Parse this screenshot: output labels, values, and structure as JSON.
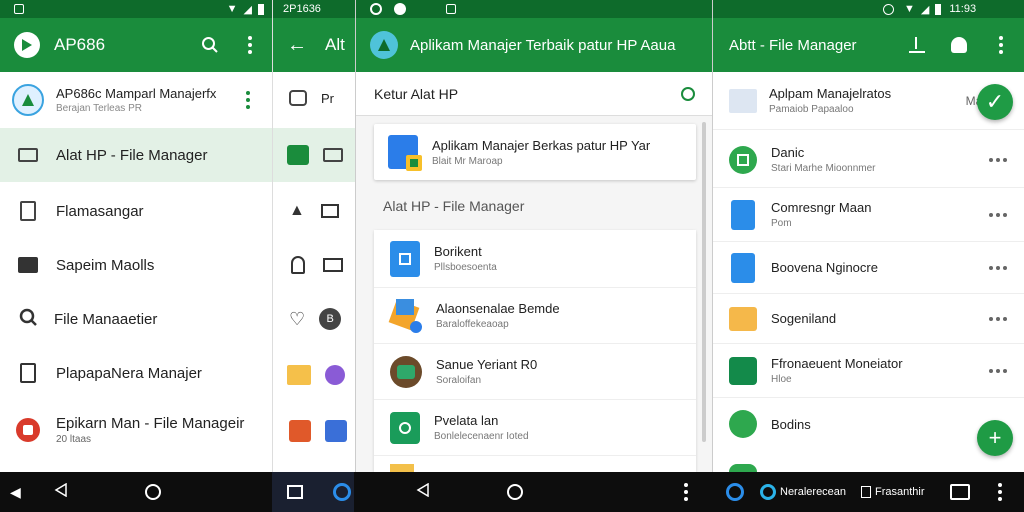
{
  "panel1": {
    "status_time": "",
    "appbar_title": "AP686",
    "account": {
      "name": "AP686c Mamparl Manajerfx",
      "sub": "Berajan Terleas PR"
    },
    "menu": [
      {
        "label": "Alat HP - File Manager",
        "icon": "screen-icon",
        "active": true
      },
      {
        "label": "Flamasangar",
        "icon": "document-icon"
      },
      {
        "label": "Sapeim Maolls",
        "icon": "folder-icon"
      },
      {
        "label": "File Manaaetier",
        "icon": "search-icon"
      },
      {
        "label": "PlapapaNera Manajer",
        "icon": "list-icon"
      },
      {
        "label": "Epikarn Man - File Manageir",
        "sub": "20 ltaas",
        "icon": "app-icon"
      }
    ]
  },
  "panel2": {
    "status_text": "2P1636",
    "appbar_title": "Alt",
    "header_item": "Pr",
    "header_item2": "B"
  },
  "panel3": {
    "appbar_title": "Aplikam Manajer Terbaik patur HP Aaua",
    "search_label": "Ketur Alat HP",
    "featured": {
      "title": "Aplikam Manajer Berkas patur HP Yar",
      "sub": "Blait Mr Maroap"
    },
    "section_title": "Alat HP - File Manager",
    "items": [
      {
        "title": "Borikent",
        "sub": "Pllsboesoenta"
      },
      {
        "title": "Alaonsenalae Bemde",
        "sub": "Baraloffekeaoap"
      },
      {
        "title": "Sanue Yeriant R0",
        "sub": "Soraloifan"
      },
      {
        "title": "Pvelata lan",
        "sub": "Bonlelecenaenr Ioted"
      }
    ]
  },
  "panel4": {
    "status_time": "11:93",
    "appbar_title": "Abtt - File Manager",
    "top_item": {
      "title": "Aplpam Manajelratos",
      "sub": "Pamaiob Papaaloo",
      "tag": "Manajes"
    },
    "items": [
      {
        "title": "Danic",
        "sub": "Stari Marhe Mioonnmer"
      },
      {
        "title": "Comresngr Maan",
        "sub": "Pom"
      },
      {
        "title": "Boovena Nginocre",
        "sub": ""
      },
      {
        "title": "Sogeniland",
        "sub": ""
      },
      {
        "title": "Ffronaeuent Moneiator",
        "sub": "Hloe"
      },
      {
        "title": "Bodins",
        "sub": ""
      }
    ]
  },
  "navbar": {
    "task_text": "Neralerecean",
    "task_text2": "Frasanthir"
  },
  "colors": {
    "primary": "#1a8c3c",
    "status": "#0e6b2b",
    "active_row": "#e3f1e6",
    "fab": "#1f9b45"
  }
}
